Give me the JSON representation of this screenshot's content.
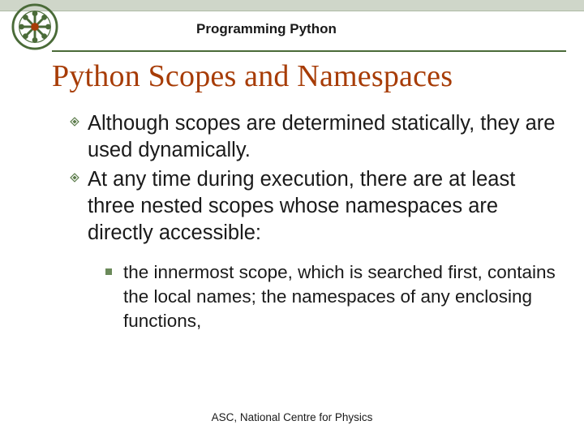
{
  "header": {
    "subject": "Programming Python",
    "logo_name": "institution-seal"
  },
  "slide": {
    "title": "Python Scopes and Namespaces",
    "bullets_level1": [
      "Although scopes are determined statically, they are used dynamically.",
      "At any time during execution, there are at least three nested scopes whose namespaces are directly accessible:"
    ],
    "bullets_level2": [
      "the innermost scope, which is searched first, contains the local names; the namespaces of any enclosing functions,"
    ]
  },
  "footer": {
    "text": "ASC, National Centre for Physics"
  },
  "colors": {
    "accent": "#A73C06",
    "rule": "#4a6b38",
    "bullet2": "#6b8a5a"
  }
}
